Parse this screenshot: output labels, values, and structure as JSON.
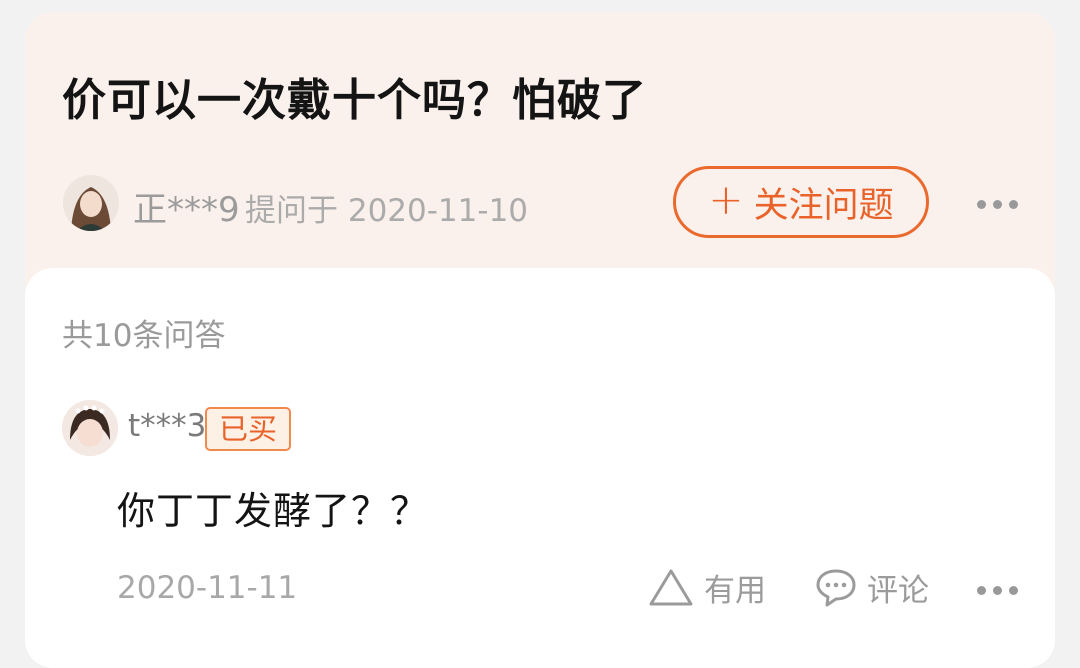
{
  "question": {
    "title": "价可以一次戴十个吗？怕破了",
    "asker_name": "正***9",
    "asked_label": "提问于 2020-11-10",
    "follow_plus": "+",
    "follow_label": "关注问题"
  },
  "answers": {
    "count_label": "共10条问答",
    "items": [
      {
        "user_name": "t***3",
        "badge": "已买",
        "text": "你丁丁发酵了？？",
        "date": "2020-11-11",
        "useful_label": "有用",
        "comment_label": "评论"
      }
    ]
  },
  "colors": {
    "accent": "#e8622a",
    "question_bg": "#fbf1ec",
    "card_bg": "#ffffff"
  },
  "icons": {
    "more": "more-dots-icon",
    "useful": "triangle-up-icon",
    "comment": "chat-bubble-icon"
  }
}
